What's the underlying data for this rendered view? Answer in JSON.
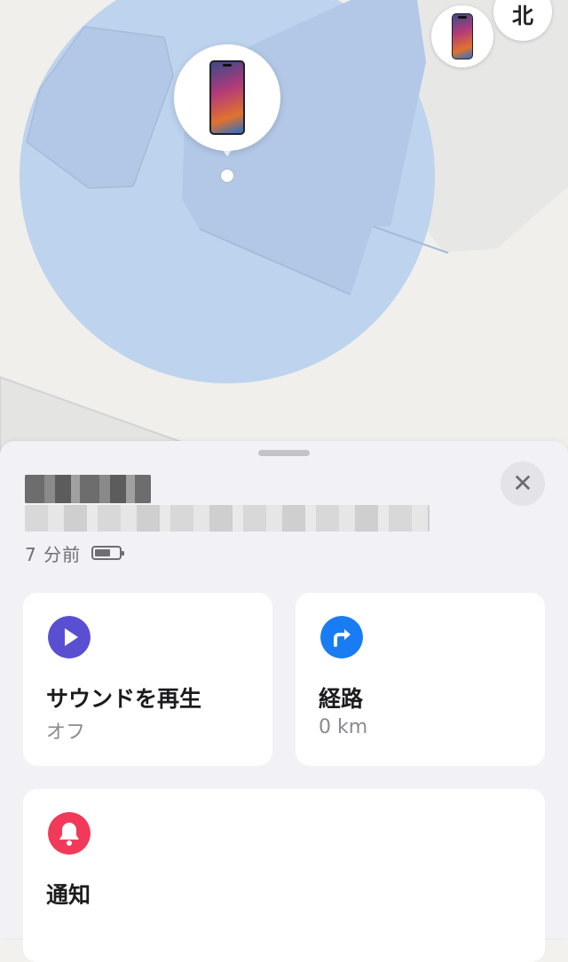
{
  "map": {
    "compass_label": "北",
    "accuracy_circle_color": "#bdd3ee",
    "building_color": "#b2c8e6"
  },
  "device": {
    "icon": "iphone-icon"
  },
  "sheet": {
    "device_name_redacted": true,
    "address_redacted": true,
    "last_seen": "7 分前",
    "battery_level": 0.7
  },
  "actions": {
    "sound": {
      "title": "サウンドを再生",
      "subtitle": "オフ",
      "icon": "play-icon",
      "color": "#5b4fd1"
    },
    "directions": {
      "title": "経路",
      "subtitle": "0 km",
      "icon": "directions-arrow-icon",
      "color": "#1a7cf2"
    },
    "notify": {
      "title": "通知",
      "icon": "bell-icon",
      "color": "#f13a5a"
    }
  },
  "close_icon": "close-icon"
}
